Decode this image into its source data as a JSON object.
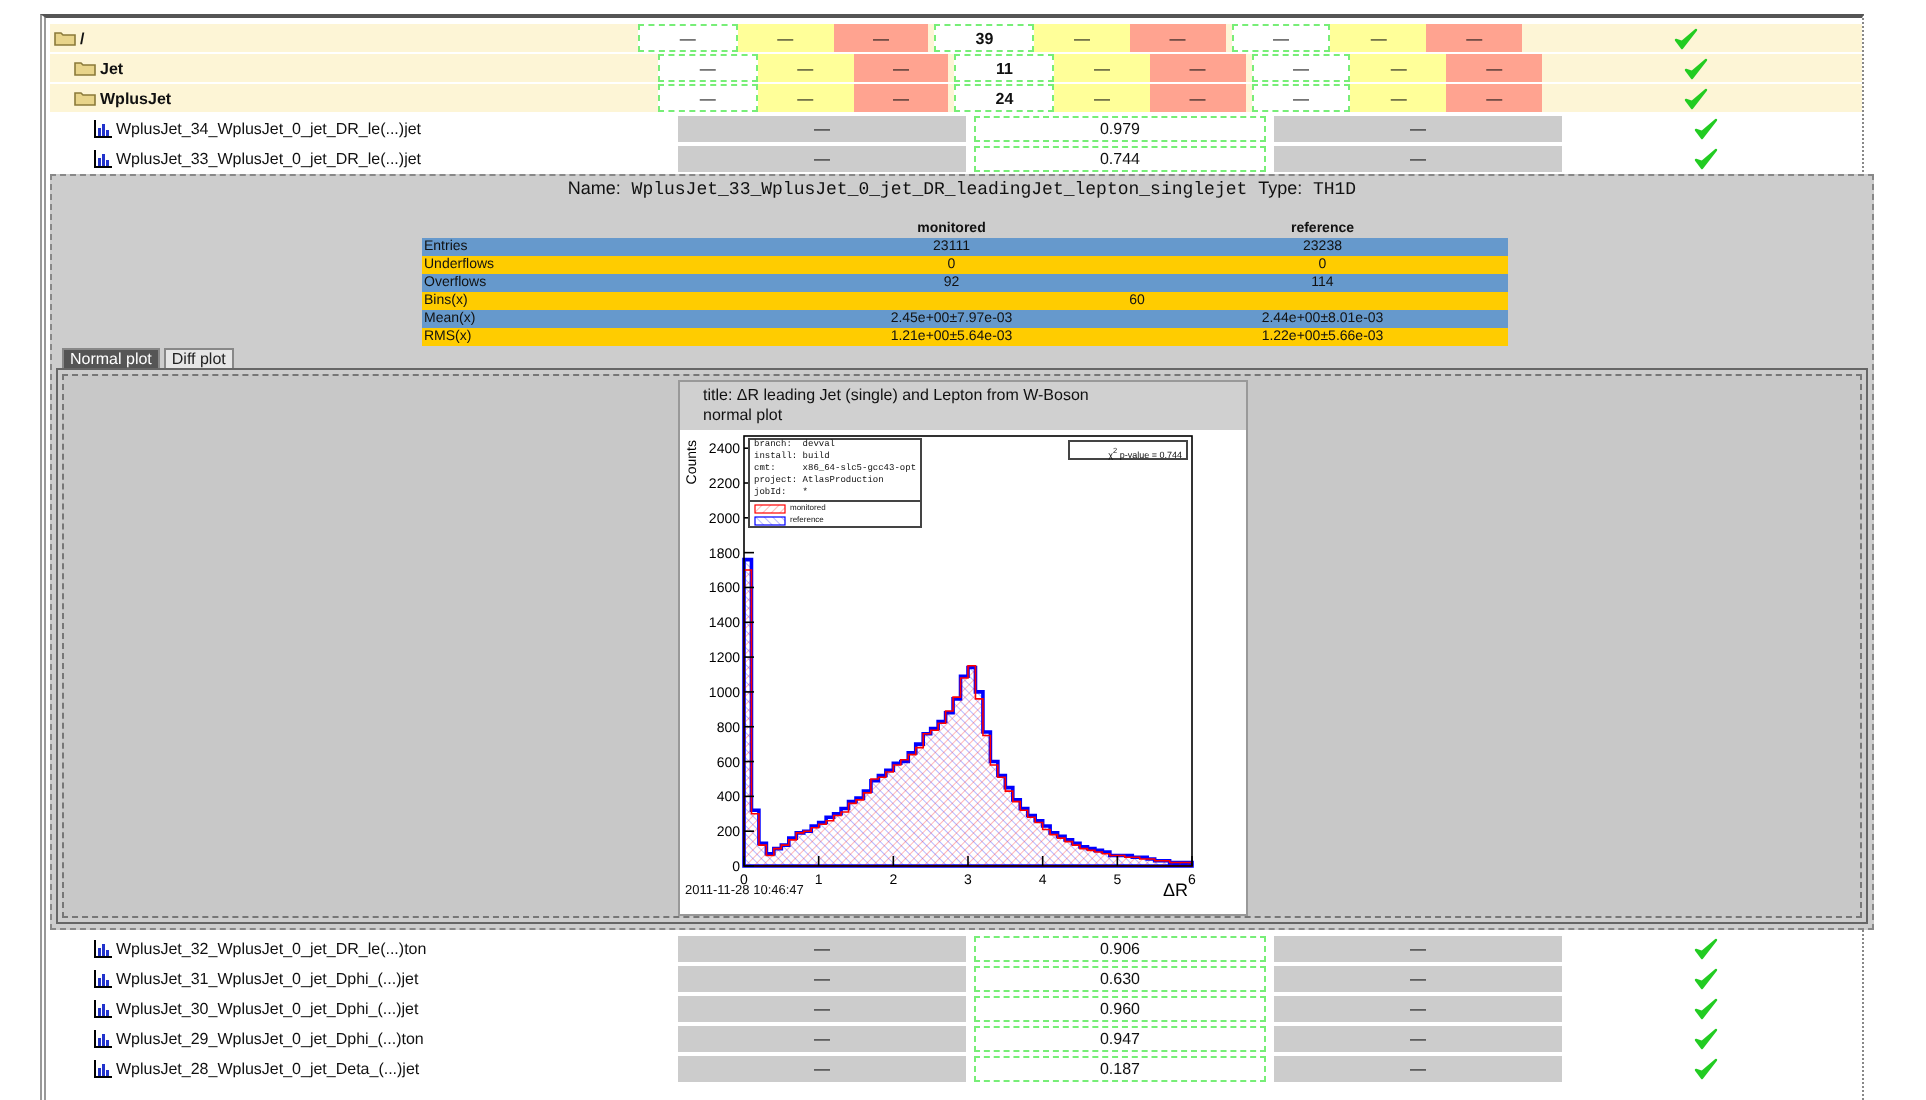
{
  "tree": [
    {
      "kind": "folder",
      "name": "/",
      "passed": true,
      "cells": [
        "—",
        "—",
        "—",
        "39",
        "—",
        "—",
        "—",
        "—",
        "—"
      ],
      "children": [
        {
          "kind": "folder",
          "name": "Jet",
          "passed": true,
          "cells": [
            "—",
            "—",
            "—",
            "11",
            "—",
            "—",
            "—",
            "—",
            "—"
          ]
        },
        {
          "kind": "folder",
          "name": "WplusJet",
          "passed": true,
          "cells": [
            "—",
            "—",
            "—",
            "24",
            "—",
            "—",
            "—",
            "—",
            "—"
          ],
          "children": [
            {
              "kind": "histogram",
              "name": "WplusJet_34_WplusJet_0_jet_DR_le(...)jet",
              "passed": true,
              "cells": [
                "—",
                "0.979",
                "—"
              ]
            },
            {
              "kind": "histogram",
              "name": "WplusJet_33_WplusJet_0_jet_DR_le(...)jet",
              "passed": true,
              "cells": [
                "—",
                "0.744",
                "—"
              ],
              "detail": {
                "name_label": "Name:",
                "name": "WplusJet_33_WplusJet_0_jet_DR_leadingJet_lepton_singlejet",
                "type_label": "Type:",
                "type": "TH1D",
                "table": {
                  "columns": [
                    "monitored",
                    "reference"
                  ],
                  "rows": [
                    {
                      "label": "Entries",
                      "values": [
                        "23111",
                        "23238"
                      ]
                    },
                    {
                      "label": "Underflows",
                      "values": [
                        "0",
                        "0"
                      ]
                    },
                    {
                      "label": "Overflows",
                      "values": [
                        "92",
                        "114"
                      ]
                    },
                    {
                      "label": "Bins(x)",
                      "values": [
                        "60"
                      ]
                    },
                    {
                      "label": "Mean(x)",
                      "values": [
                        "2.45e+00±7.97e-03",
                        "2.44e+00±8.01e-03"
                      ]
                    },
                    {
                      "label": "RMS(x)",
                      "values": [
                        "1.21e+00±5.64e-03",
                        "1.22e+00±5.66e-03"
                      ]
                    }
                  ]
                },
                "tabs": [
                  {
                    "label": "Normal plot",
                    "selected": true
                  },
                  {
                    "label": "Diff plot",
                    "selected": false
                  }
                ],
                "plot": {
                  "title": "title: ΔR leading Jet (single) and Lepton from W-Boson",
                  "subtitle": "normal plot",
                  "info": [
                    "branch:  devval",
                    "install: build",
                    "cmt:     x86_64-slc5-gcc43-opt",
                    "project: AtlasProduction",
                    "jobId:   *"
                  ],
                  "pvalue": "χ$^{2}$ p-value = 0.744",
                  "timestamp": "2011-11-28 10:46:47",
                  "chart_data": {
                    "type": "area",
                    "xlabel": "ΔR",
                    "ylabel": "Counts",
                    "xlim": [
                      0,
                      6
                    ],
                    "ylim": [
                      0,
                      2470
                    ],
                    "xticks": [
                      0,
                      1,
                      2,
                      3,
                      4,
                      5,
                      6
                    ],
                    "yticks": [
                      0,
                      200,
                      400,
                      600,
                      800,
                      1000,
                      1200,
                      1400,
                      1600,
                      1800,
                      2000,
                      2200,
                      2400
                    ],
                    "legend": true,
                    "x": [
                      0.05,
                      0.15,
                      0.25,
                      0.35,
                      0.45,
                      0.55,
                      0.65,
                      0.75,
                      0.85,
                      0.95,
                      1.05,
                      1.15,
                      1.25,
                      1.35,
                      1.45,
                      1.55,
                      1.65,
                      1.75,
                      1.85,
                      1.95,
                      2.05,
                      2.15,
                      2.25,
                      2.35,
                      2.45,
                      2.55,
                      2.65,
                      2.75,
                      2.85,
                      2.95,
                      3.05,
                      3.15,
                      3.25,
                      3.35,
                      3.45,
                      3.55,
                      3.65,
                      3.75,
                      3.85,
                      3.95,
                      4.05,
                      4.15,
                      4.25,
                      4.35,
                      4.45,
                      4.55,
                      4.65,
                      4.75,
                      4.85,
                      4.95,
                      5.05,
                      5.15,
                      5.25,
                      5.35,
                      5.45,
                      5.55,
                      5.65,
                      5.75,
                      5.85,
                      5.95
                    ],
                    "series": [
                      {
                        "name": "monitored",
                        "color": "#ff0000",
                        "values": [
                          1700,
                          300,
                          120,
                          60,
                          100,
                          120,
                          150,
                          190,
                          200,
                          220,
                          240,
                          260,
                          290,
                          310,
                          360,
                          380,
                          420,
                          500,
                          510,
                          540,
                          580,
                          610,
                          640,
                          680,
                          760,
                          780,
                          820,
                          890,
                          970,
                          1080,
                          1150,
                          960,
                          750,
                          580,
                          510,
                          430,
                          370,
                          320,
                          280,
                          250,
                          210,
                          180,
                          160,
                          140,
                          120,
                          100,
                          90,
                          80,
                          70,
                          60,
                          60,
                          50,
                          50,
                          40,
                          40,
                          30,
                          30,
                          20,
                          20,
                          20
                        ]
                      },
                      {
                        "name": "reference",
                        "color": "#0000ff",
                        "values": [
                          1760,
                          320,
                          130,
                          70,
                          100,
                          120,
                          160,
                          190,
                          200,
                          230,
                          250,
                          280,
                          300,
                          330,
                          370,
                          390,
                          430,
                          490,
                          520,
                          550,
                          590,
                          600,
                          650,
                          700,
                          760,
                          790,
                          830,
                          880,
                          960,
                          1090,
                          1140,
                          1000,
                          770,
                          600,
                          520,
                          450,
                          380,
                          330,
                          290,
                          260,
                          230,
                          190,
                          170,
                          150,
                          130,
                          110,
                          100,
                          90,
                          80,
                          60,
                          60,
                          60,
                          50,
                          50,
                          40,
                          30,
                          30,
                          20,
                          20,
                          20
                        ]
                      }
                    ]
                  }
                }
              }
            },
            {
              "kind": "histogram",
              "name": "WplusJet_32_WplusJet_0_jet_DR_le(...)ton",
              "passed": true,
              "cells": [
                "—",
                "0.906",
                "—"
              ]
            },
            {
              "kind": "histogram",
              "name": "WplusJet_31_WplusJet_0_jet_Dphi_(...)jet",
              "passed": true,
              "cells": [
                "—",
                "0.630",
                "—"
              ]
            },
            {
              "kind": "histogram",
              "name": "WplusJet_30_WplusJet_0_jet_Dphi_(...)jet",
              "passed": true,
              "cells": [
                "—",
                "0.960",
                "—"
              ]
            },
            {
              "kind": "histogram",
              "name": "WplusJet_29_WplusJet_0_jet_Dphi_(...)ton",
              "passed": true,
              "cells": [
                "—",
                "0.947",
                "—"
              ]
            },
            {
              "kind": "histogram",
              "name": "WplusJet_28_WplusJet_0_jet_Deta_(...)jet",
              "passed": true,
              "cells": [
                "—",
                "0.187",
                "—"
              ]
            }
          ]
        }
      ]
    }
  ]
}
